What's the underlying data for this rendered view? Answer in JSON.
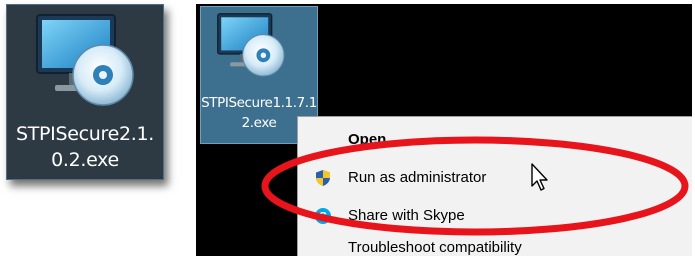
{
  "files": [
    {
      "name": "STPISecure2.1.0.2.exe",
      "icon": "installer-monitor-disc-icon"
    },
    {
      "name": "STPISecure1.1.7.12.exe",
      "icon": "installer-monitor-disc-icon"
    }
  ],
  "context_menu": {
    "items": [
      {
        "label": "Open",
        "icon": ""
      },
      {
        "label": "Run as administrator",
        "icon": "uac-shield-icon"
      },
      {
        "label": "Share with Skype",
        "icon": "skype-icon"
      },
      {
        "label": "Troubleshoot compatibility",
        "icon": ""
      }
    ]
  },
  "colors": {
    "highlight_ring": "#e8141b",
    "tile_selected": "#3d6f8e",
    "tile_dark": "#2d3a43",
    "menu_bg": "#f2f2f2"
  }
}
